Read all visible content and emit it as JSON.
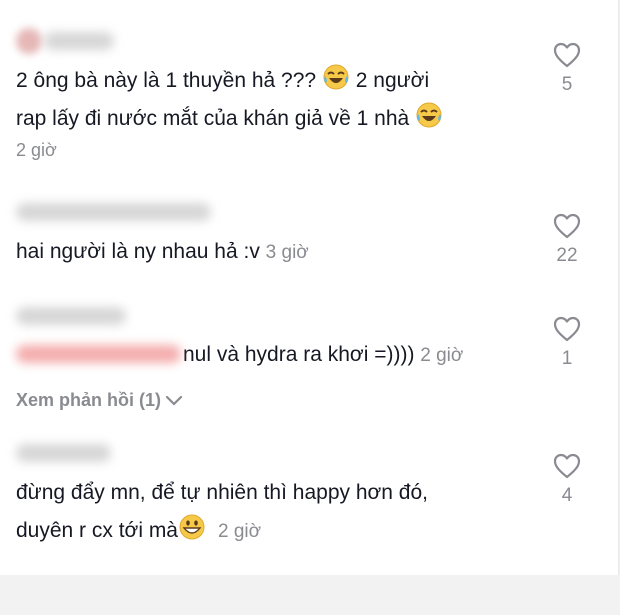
{
  "comments": [
    {
      "line1": "2 ông bà này là 1 thuyền hả ??? ",
      "line1b": " 2 người",
      "line2": "rap lấy đi nước mắt của khán giả về 1 nhà ",
      "time": "2 giờ",
      "likes": "5",
      "emoji": "face-with-tears-of-joy"
    },
    {
      "line1": "hai người là ny nhau hả :v ",
      "time": "3 giờ",
      "likes": "22"
    },
    {
      "line1": "nul và hydra ra khơi =)))) ",
      "time": "2 giờ",
      "likes": "1",
      "replies": "Xem phản hồi (1)"
    },
    {
      "line1": "đừng đẩy mn, để tự nhiên thì happy hơn đó,",
      "line2": "duyên r cx tới mà",
      "time": "2 giờ",
      "likes": "4",
      "emoji": "grinning-face"
    }
  ],
  "icons": {
    "like": "heart-outline-icon",
    "expand": "chevron-down-icon"
  },
  "colors": {
    "text": "#161823",
    "secondary": "#8a8b91",
    "background": "#ffffff"
  }
}
